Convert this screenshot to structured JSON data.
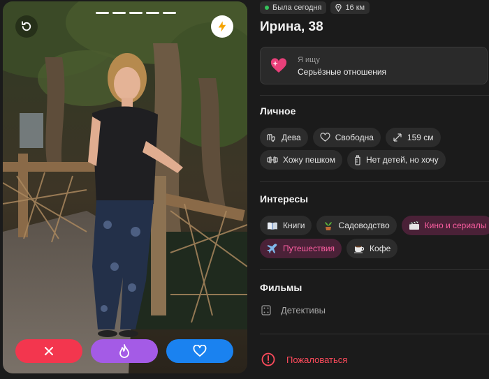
{
  "profile": {
    "status_online": "Была сегодня",
    "distance": "16 км",
    "name_age": "Ирина, 38",
    "photo_count": 5,
    "photo_index": 1
  },
  "looking_for": {
    "label": "Я ищу",
    "value": "Серьёзные отношения"
  },
  "personal": {
    "title": "Личное",
    "chips": [
      {
        "icon": "virgo-icon",
        "label": "Дева"
      },
      {
        "icon": "heart-outline-icon",
        "label": "Свободна"
      },
      {
        "icon": "height-arrows-icon",
        "label": "159 см"
      },
      {
        "icon": "dumbbell-icon",
        "label": "Хожу пешком"
      },
      {
        "icon": "baby-bottle-icon",
        "label": "Нет детей, но хочу"
      }
    ]
  },
  "interests": {
    "title": "Интересы",
    "chips": [
      {
        "icon": "book-icon",
        "label": "Книги",
        "highlight": false
      },
      {
        "icon": "plant-icon",
        "label": "Садоводство",
        "highlight": false
      },
      {
        "icon": "clapper-icon",
        "label": "Кино и сериалы",
        "highlight": true
      },
      {
        "icon": "airplane-icon",
        "label": "Путешествия",
        "highlight": true
      },
      {
        "icon": "coffee-icon",
        "label": "Кофе",
        "highlight": false
      }
    ]
  },
  "movies": {
    "title": "Фильмы",
    "value": "Детективы"
  },
  "report_label": "Пожаловаться",
  "colors": {
    "background": "#1b1b1b",
    "dislike": "#f3364e",
    "superlike": "#a45be6",
    "like": "#1a82f0",
    "highlight_text": "#ff5fa3",
    "online": "#35c35b",
    "report": "#ff4b5c"
  }
}
